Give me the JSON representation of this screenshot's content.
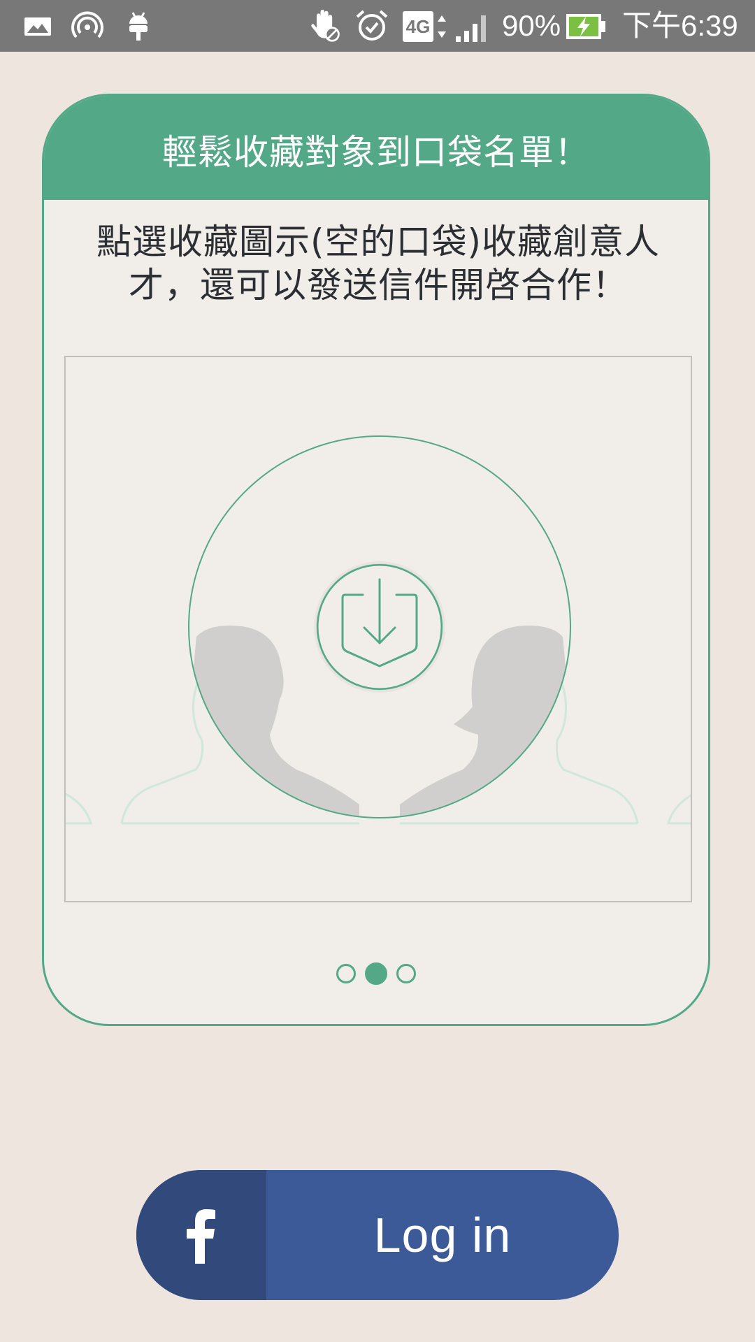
{
  "status_bar": {
    "battery": "90%",
    "time": "下午6:39",
    "network": "4G",
    "icons": [
      "gallery-icon",
      "hotspot-icon",
      "android-debug-icon",
      "do-not-disturb-hand-icon",
      "alarm-icon",
      "network-4g-icon",
      "signal-icon",
      "battery-charging-icon"
    ]
  },
  "card": {
    "title": "輕鬆收藏對象到口袋名單！",
    "description": "點選收藏圖示(空的口袋)收藏創意人才，還可以發送信件開啓合作！",
    "illustration_icon": "pocket-download-icon",
    "pager": {
      "total": 3,
      "active_index": 1
    }
  },
  "login": {
    "label": "Log in",
    "icon": "facebook-icon"
  },
  "colors": {
    "accent": "#53a987",
    "background": "#ede5de",
    "card_bg": "#f1ede8",
    "facebook_blue": "#3c5998",
    "facebook_dark": "#32497c",
    "status_bar": "#787878"
  }
}
